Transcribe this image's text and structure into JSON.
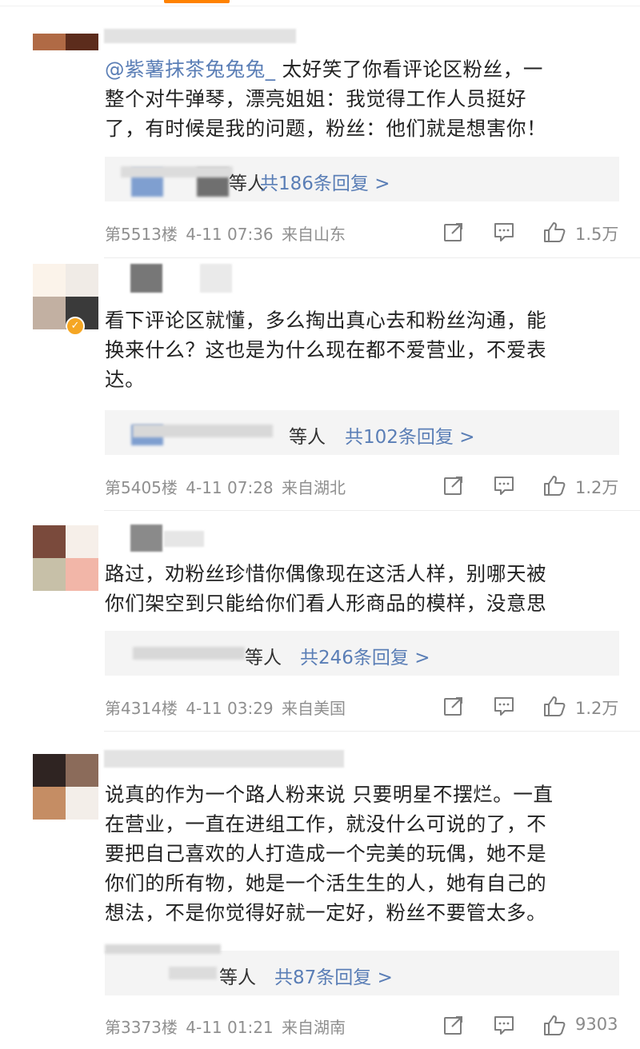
{
  "comments": [
    {
      "avatar_colors": [
        "#b06a45",
        "#5c2c1c",
        "#fbeee6",
        "#e8d3c8"
      ],
      "verified": false,
      "mention": "@紫薯抹茶兔兔兔_",
      "lines": [
        "太好笑了你看评论区粉丝，一",
        "整个对牛弹琴，漂亮姐姐：我觉得工作人员挺好",
        "了，有时候是我的问题，粉丝：他们就是想害你！"
      ],
      "reply_names_suffix": "等人",
      "reply_count": "共186条回复 >",
      "floor": "第5513楼",
      "time": "4-11 07:36",
      "location": "来自山东",
      "likes": "1.5万"
    },
    {
      "avatar_colors": [
        "#fbf3ea",
        "#f0ebe6",
        "#c2b0a2",
        "#3a3a3a"
      ],
      "verified": true,
      "mention": "",
      "lines": [
        "看下评论区就懂，多么掏出真心去和粉丝沟通，能",
        "换来什么？这也是为什么现在都不爱营业，不爱表",
        "达。"
      ],
      "reply_names_suffix": "等人",
      "reply_count": "共102条回复 >",
      "floor": "第5405楼",
      "time": "4-11 07:28",
      "location": "来自湖北",
      "likes": "1.2万"
    },
    {
      "avatar_colors": [
        "#7a4a3c",
        "#f6efe9",
        "#c7c0a8",
        "#f2b6a8"
      ],
      "verified": false,
      "mention": "",
      "lines": [
        "路过，劝粉丝珍惜你偶像现在这活人样，别哪天被",
        "你们架空到只能给你们看人形商品的模样，没意思"
      ],
      "reply_names_suffix": "等人",
      "reply_count": "共246条回复 >",
      "floor": "第4314楼",
      "time": "4-11 03:29",
      "location": "来自美国",
      "likes": "1.2万"
    },
    {
      "avatar_colors": [
        "#2f2422",
        "#8b6b5a",
        "#c58d64",
        "#f3eee9"
      ],
      "verified": false,
      "mention": "",
      "lines": [
        "说真的作为一个路人粉来说 只要明星不摆烂。一直",
        "在营业，一直在进组工作，就没什么可说的了，不",
        "要把自己喜欢的人打造成一个完美的玩偶，她不是",
        "你们的所有物，她是一个活生生的人，她有自己的",
        "想法，不是你觉得好就一定好，粉丝不要管太多。"
      ],
      "reply_names_suffix": "等人",
      "reply_count": "共87条回复 >",
      "floor": "第3373楼",
      "time": "4-11 01:21",
      "location": "来自湖南",
      "likes": "9303"
    }
  ],
  "icons": {
    "share": "share-icon",
    "comment": "comment-icon",
    "like": "thumbs-up-icon",
    "verified": "verified-badge-icon"
  },
  "colors": {
    "accent": "#5a7eb6",
    "meta_text": "#8f8f8f",
    "reply_bg": "#f4f4f4",
    "verified_badge": "#f5a623",
    "tab_indicator": "#ff8200"
  }
}
